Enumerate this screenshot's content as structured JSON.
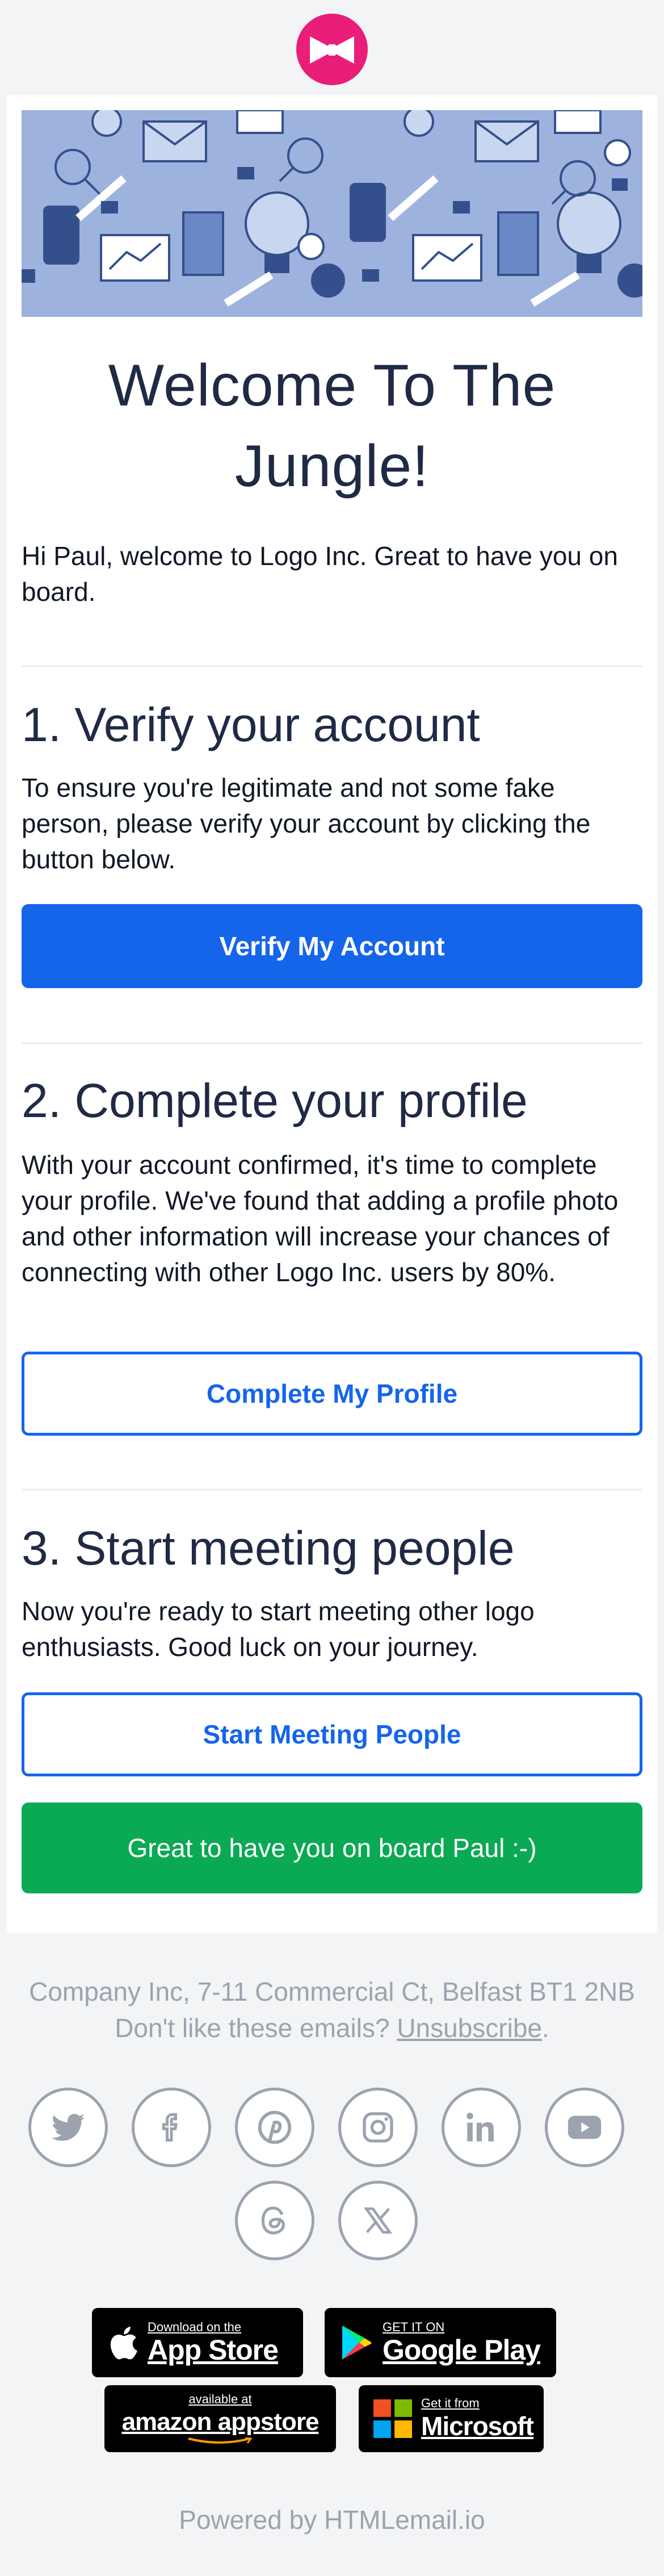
{
  "brand": {
    "logo_icon": "bowtie-logo-icon",
    "color": "#e91e78"
  },
  "hero": {
    "illustration": "office-icons-pattern"
  },
  "welcome": {
    "title": "Welcome To The Jungle!",
    "intro": "Hi Paul, welcome to Logo Inc. Great to have you on board."
  },
  "steps": [
    {
      "heading": "1. Verify your account",
      "text": "To ensure you're legitimate and not some fake person, please verify your account by clicking the button below.",
      "button": "Verify My Account"
    },
    {
      "heading": "2. Complete your profile",
      "text": "With your account confirmed, it's time to complete your profile. We've found that adding a profile photo and other information will increase your chances of connecting with other Logo Inc. users by 80%.",
      "button": "Complete My Profile"
    },
    {
      "heading": "3. Start meeting people",
      "text": "Now you're ready to start meeting other logo enthusiasts. Good luck on your journey.",
      "button": "Start Meeting People"
    }
  ],
  "closing_button": "Great to have you on board Paul :-)",
  "footer": {
    "address": "Company Inc, 7-11 Commercial Ct, Belfast BT1 2NB",
    "unsubscribe_prefix": "Don't like these emails? ",
    "unsubscribe_link": "Unsubscribe",
    "unsubscribe_suffix": ".",
    "social": [
      "twitter-icon",
      "facebook-icon",
      "pinterest-icon",
      "instagram-icon",
      "linkedin-icon",
      "youtube-icon",
      "threads-icon",
      "x-icon"
    ],
    "stores": {
      "apple_small": "Download on the",
      "apple_big": "App Store",
      "google_small": "GET IT ON",
      "google_big": "Google Play",
      "amazon_small": "available at",
      "amazon_big": "amazon appstore",
      "microsoft_small": "Get it from",
      "microsoft_big": "Microsoft"
    },
    "powered_by": "Powered by HTMLemail.io"
  },
  "colors": {
    "primary": "#1565eb",
    "success": "#0aa954",
    "text": "#111827",
    "heading": "#1f2a44",
    "muted": "#9ca3af"
  }
}
